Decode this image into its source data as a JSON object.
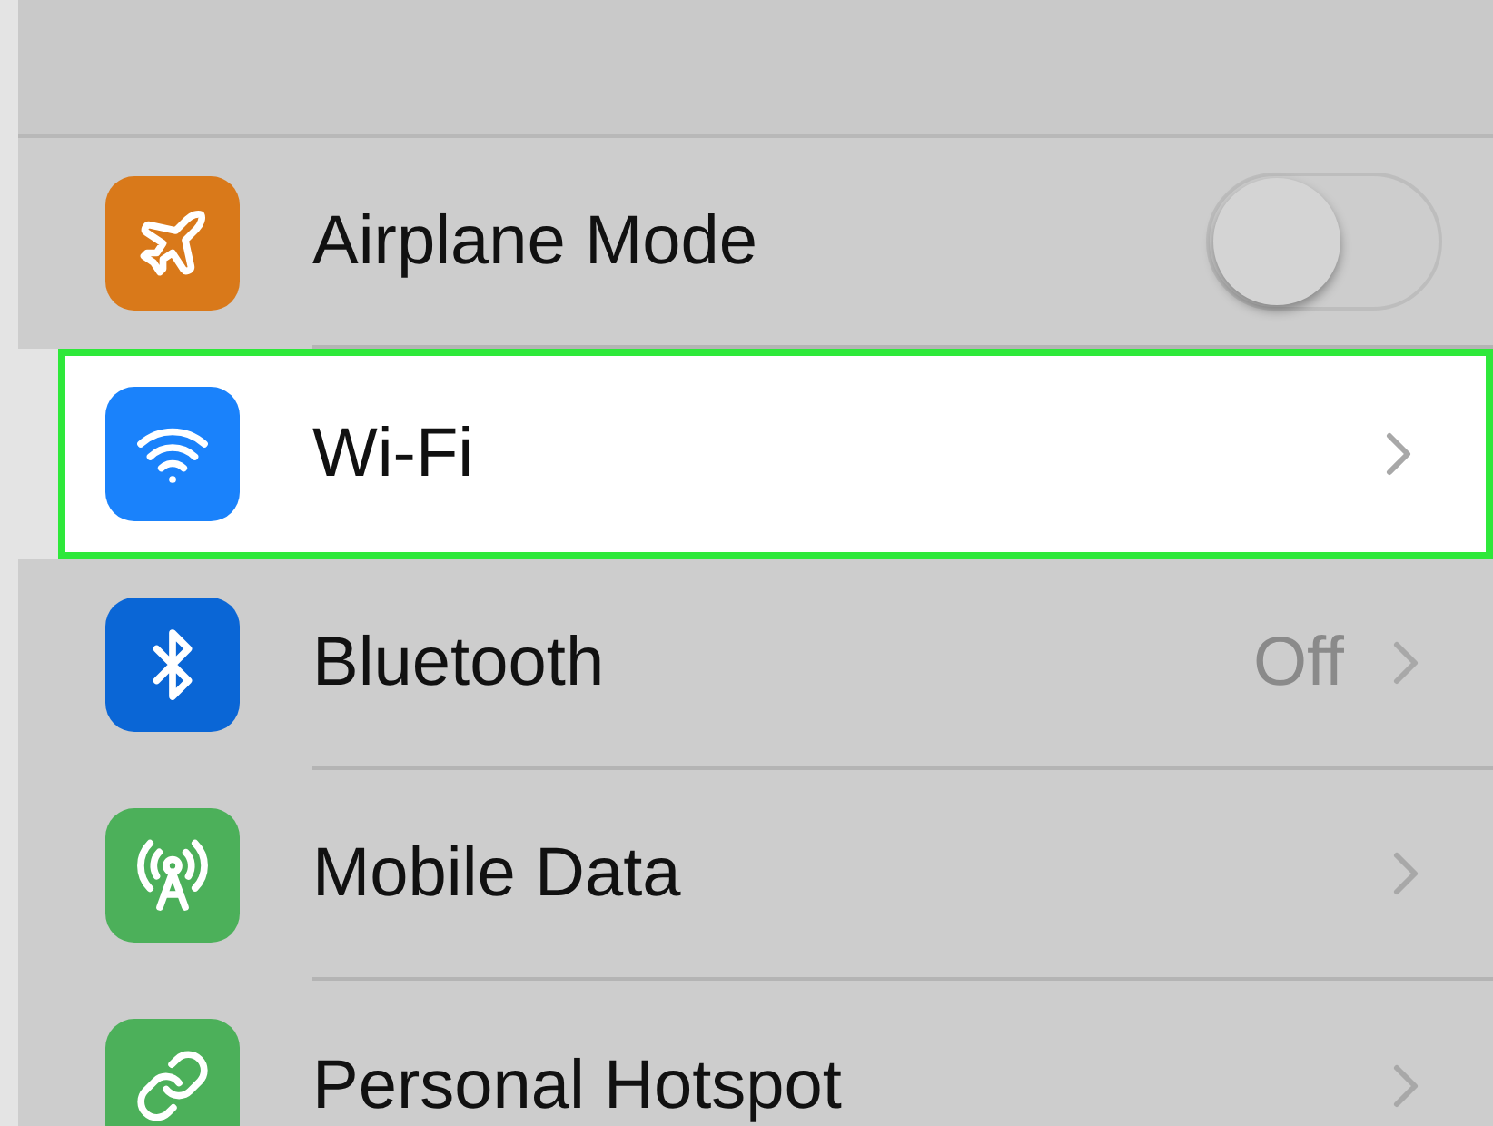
{
  "settings": [
    {
      "kind": "toggle",
      "color": "#d9791a",
      "label": "Airplane Mode",
      "on": false,
      "selected": false
    },
    {
      "kind": "link",
      "color": "#1a82fb",
      "label": "Wi-Fi",
      "selected": true
    },
    {
      "kind": "link",
      "color": "#0a66d6",
      "label": "Bluetooth",
      "value": "Off",
      "selected": false
    },
    {
      "kind": "link",
      "color": "#4cb05a",
      "label": "Mobile Data",
      "selected": false
    },
    {
      "kind": "link",
      "color": "#4cb05a",
      "label": "Personal Hotspot",
      "selected": false
    }
  ]
}
